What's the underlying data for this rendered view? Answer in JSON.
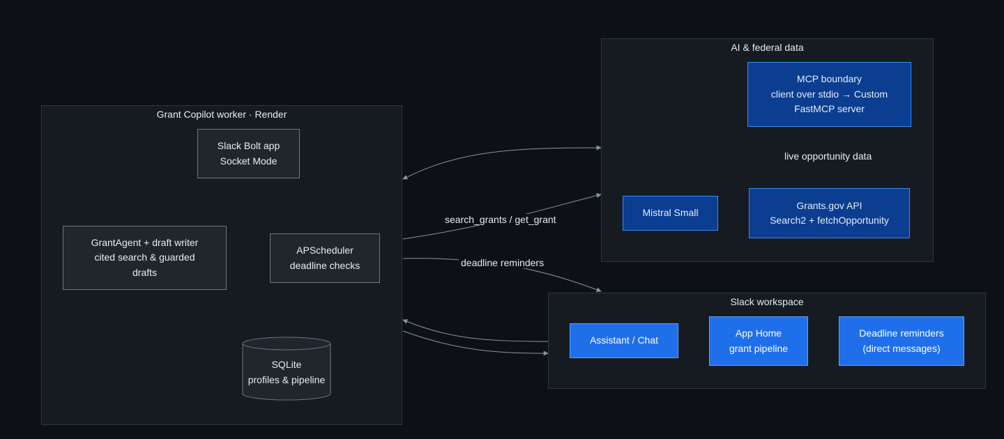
{
  "clusters": {
    "worker": {
      "title": "Grant Copilot worker · Render"
    },
    "ai": {
      "title": "AI & federal data"
    },
    "slack": {
      "title": "Slack workspace"
    }
  },
  "nodes": {
    "slack_bolt": {
      "line1": "Slack Bolt app",
      "line2": "Socket Mode"
    },
    "grant_agent": {
      "line1": "GrantAgent + draft writer",
      "line2": "cited search & guarded",
      "line3": "drafts"
    },
    "apscheduler": {
      "line1": "APScheduler",
      "line2": "deadline checks"
    },
    "sqlite": {
      "line1": "SQLite",
      "line2": "profiles & pipeline"
    },
    "mcp": {
      "line1": "MCP boundary",
      "line2": "client over stdio → Custom",
      "line3": "FastMCP server"
    },
    "mistral": {
      "line1": "Mistral Small"
    },
    "grants_api": {
      "line1": "Grants.gov API",
      "line2": "Search2 + fetchOpportunity"
    },
    "assistant": {
      "line1": "Assistant / Chat"
    },
    "app_home": {
      "line1": "App Home",
      "line2": "grant pipeline"
    },
    "reminders": {
      "line1": "Deadline reminders",
      "line2": "(direct messages)"
    }
  },
  "edges": {
    "search": "search_grants / get_grant",
    "deadline": "deadline reminders",
    "live": "live opportunity data"
  },
  "colors": {
    "background": "#0d1117",
    "cluster": "#161b22",
    "edge": "#8b949e",
    "mcp_fill": "#0b3d91",
    "slack_fill": "#1f6feb"
  }
}
